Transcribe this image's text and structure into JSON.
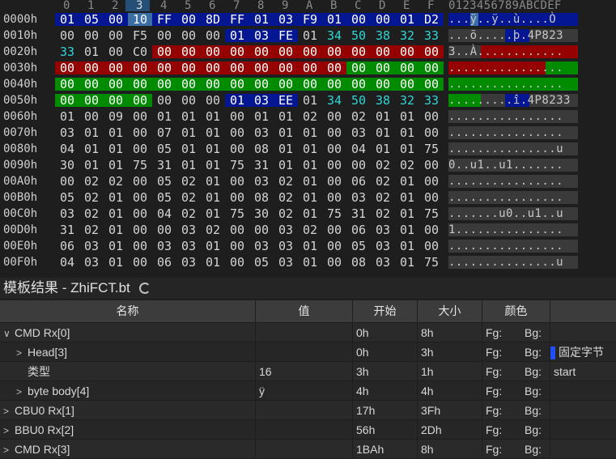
{
  "hex": {
    "columns": [
      "0",
      "1",
      "2",
      "3",
      "4",
      "5",
      "6",
      "7",
      "8",
      "9",
      "A",
      "B",
      "C",
      "D",
      "E",
      "F"
    ],
    "ascii_header": "0123456789ABCDEF",
    "rows": [
      {
        "offset": "0000h",
        "bytes": [
          "01",
          "05",
          "00",
          "10",
          "FF",
          "00",
          "8D",
          "FF",
          "01",
          "03",
          "F9",
          "01",
          "00",
          "00",
          "01",
          "D2"
        ],
        "ascii": "...ÿ..ÿ..ù....Ò"
      },
      {
        "offset": "0010h",
        "bytes": [
          "00",
          "00",
          "00",
          "F5",
          "00",
          "00",
          "00",
          "01",
          "03",
          "FE",
          "01",
          "34",
          "50",
          "38",
          "32",
          "33"
        ],
        "ascii": "...õ.....þ.4P823"
      },
      {
        "offset": "0020h",
        "bytes": [
          "33",
          "01",
          "00",
          "C0",
          "00",
          "00",
          "00",
          "00",
          "00",
          "00",
          "00",
          "00",
          "00",
          "00",
          "00",
          "00"
        ],
        "ascii": "3..À............"
      },
      {
        "offset": "0030h",
        "bytes": [
          "00",
          "00",
          "00",
          "00",
          "00",
          "00",
          "00",
          "00",
          "00",
          "00",
          "00",
          "00",
          "00",
          "00",
          "00",
          "00"
        ],
        "ascii": "................"
      },
      {
        "offset": "0040h",
        "bytes": [
          "00",
          "00",
          "00",
          "00",
          "00",
          "00",
          "00",
          "00",
          "00",
          "00",
          "00",
          "00",
          "00",
          "00",
          "00",
          "00"
        ],
        "ascii": "................"
      },
      {
        "offset": "0050h",
        "bytes": [
          "00",
          "00",
          "00",
          "00",
          "00",
          "00",
          "00",
          "01",
          "03",
          "EE",
          "01",
          "34",
          "50",
          "38",
          "32",
          "33"
        ],
        "ascii": ".........î.4P8233"
      },
      {
        "offset": "0060h",
        "bytes": [
          "01",
          "00",
          "09",
          "00",
          "01",
          "01",
          "01",
          "00",
          "01",
          "01",
          "02",
          "00",
          "02",
          "01",
          "01",
          "00"
        ],
        "ascii": "................"
      },
      {
        "offset": "0070h",
        "bytes": [
          "03",
          "01",
          "01",
          "00",
          "07",
          "01",
          "01",
          "00",
          "03",
          "01",
          "01",
          "00",
          "03",
          "01",
          "01",
          "00"
        ],
        "ascii": "................"
      },
      {
        "offset": "0080h",
        "bytes": [
          "04",
          "01",
          "01",
          "00",
          "05",
          "01",
          "01",
          "00",
          "08",
          "01",
          "01",
          "00",
          "04",
          "01",
          "01",
          "75"
        ],
        "ascii": "...............u"
      },
      {
        "offset": "0090h",
        "bytes": [
          "30",
          "01",
          "01",
          "75",
          "31",
          "01",
          "01",
          "75",
          "31",
          "01",
          "01",
          "00",
          "00",
          "02",
          "02",
          "00"
        ],
        "ascii": "0..u1..u1......."
      },
      {
        "offset": "00A0h",
        "bytes": [
          "00",
          "02",
          "02",
          "00",
          "05",
          "02",
          "01",
          "00",
          "03",
          "02",
          "01",
          "00",
          "06",
          "02",
          "01",
          "00"
        ],
        "ascii": "................"
      },
      {
        "offset": "00B0h",
        "bytes": [
          "05",
          "02",
          "01",
          "00",
          "05",
          "02",
          "01",
          "00",
          "08",
          "02",
          "01",
          "00",
          "03",
          "02",
          "01",
          "00"
        ],
        "ascii": "................"
      },
      {
        "offset": "00C0h",
        "bytes": [
          "03",
          "02",
          "01",
          "00",
          "04",
          "02",
          "01",
          "75",
          "30",
          "02",
          "01",
          "75",
          "31",
          "02",
          "01",
          "75"
        ],
        "ascii": ".......u0..u1..u"
      },
      {
        "offset": "00D0h",
        "bytes": [
          "31",
          "02",
          "01",
          "00",
          "00",
          "03",
          "02",
          "00",
          "00",
          "03",
          "02",
          "00",
          "06",
          "03",
          "01",
          "00"
        ],
        "ascii": "1..............."
      },
      {
        "offset": "00E0h",
        "bytes": [
          "06",
          "03",
          "01",
          "00",
          "03",
          "03",
          "01",
          "00",
          "03",
          "03",
          "01",
          "00",
          "05",
          "03",
          "01",
          "00"
        ],
        "ascii": "................"
      },
      {
        "offset": "00F0h",
        "bytes": [
          "04",
          "03",
          "01",
          "00",
          "06",
          "03",
          "01",
          "00",
          "05",
          "03",
          "01",
          "00",
          "08",
          "03",
          "01",
          "75"
        ],
        "ascii": "...............u"
      }
    ]
  },
  "template": {
    "title": "模板结果 - ZhiFCT.bt",
    "columns": {
      "name": "名称",
      "value": "值",
      "start": "开始",
      "size": "大小",
      "color": "颜色"
    },
    "rows": [
      {
        "toggle": "∨",
        "indent": 0,
        "name": "CMD Rx[0]",
        "value": "",
        "start": "0h",
        "size": "8h",
        "fg": "Fg:",
        "bg": "Bg:",
        "comment": ""
      },
      {
        "toggle": ">",
        "indent": 1,
        "name": "Head[3]",
        "value": "",
        "start": "0h",
        "size": "3h",
        "fg": "Fg:",
        "bg": "Bg:",
        "comment": "固定字节",
        "swatch": true
      },
      {
        "toggle": "",
        "indent": 1,
        "name": "类型",
        "value": "16",
        "start": "3h",
        "size": "1h",
        "fg": "Fg:",
        "bg": "Bg:",
        "comment": "start"
      },
      {
        "toggle": ">",
        "indent": 1,
        "name": "byte body[4]",
        "value": "ÿ",
        "start": "4h",
        "size": "4h",
        "fg": "Fg:",
        "bg": "Bg:",
        "comment": ""
      },
      {
        "toggle": ">",
        "indent": 0,
        "name": "CBU0 Rx[1]",
        "value": "",
        "start": "17h",
        "size": "3Fh",
        "fg": "Fg:",
        "bg": "Bg:",
        "comment": ""
      },
      {
        "toggle": ">",
        "indent": 0,
        "name": "BBU0 Rx[2]",
        "value": "",
        "start": "56h",
        "size": "2Dh",
        "fg": "Fg:",
        "bg": "Bg:",
        "comment": ""
      },
      {
        "toggle": ">",
        "indent": 0,
        "name": "CMD Rx[3]",
        "value": "",
        "start": "1BAh",
        "size": "8h",
        "fg": "Fg:",
        "bg": "Bg:",
        "comment": ""
      }
    ]
  },
  "colors": {
    "blue": "#041691",
    "red": "#950000",
    "green": "#008b00",
    "cyan": "#2fd6d6"
  }
}
